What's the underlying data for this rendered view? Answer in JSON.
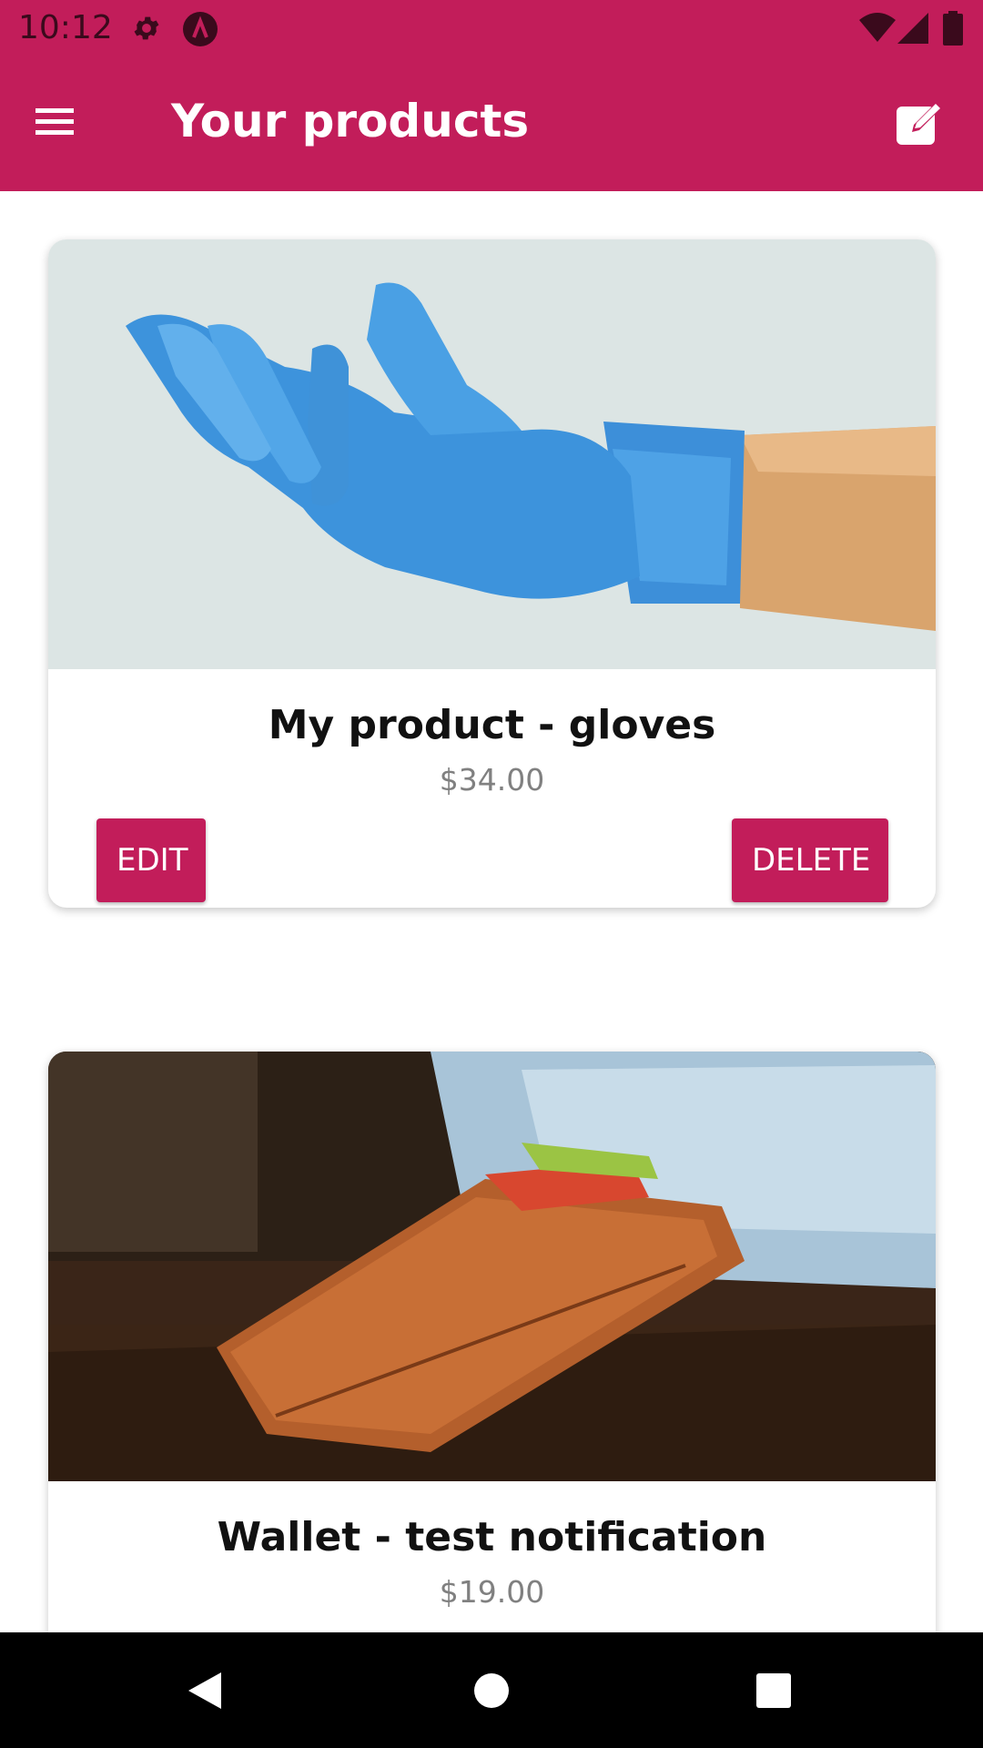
{
  "status_bar": {
    "time": "10:12",
    "icons": [
      "gear-icon",
      "app-notification-icon",
      "wifi-icon",
      "signal-icon",
      "battery-icon"
    ]
  },
  "app_bar": {
    "title": "Your products",
    "menu_icon": "hamburger-menu-icon",
    "action_icon": "edit-compose-icon"
  },
  "products": [
    {
      "title": "My product - gloves",
      "price": "$34.00",
      "image": "blue-glove-photo",
      "edit_label": "EDIT",
      "delete_label": "DELETE"
    },
    {
      "title": "Wallet - test notification",
      "price": "$19.00",
      "image": "brown-wallet-photo"
    }
  ],
  "nav_bar": {
    "icons": [
      "back-icon",
      "home-icon",
      "recents-icon"
    ]
  },
  "colors": {
    "primary": "#c21d5a",
    "button_text": "#ffffff",
    "price_text": "#808080"
  }
}
